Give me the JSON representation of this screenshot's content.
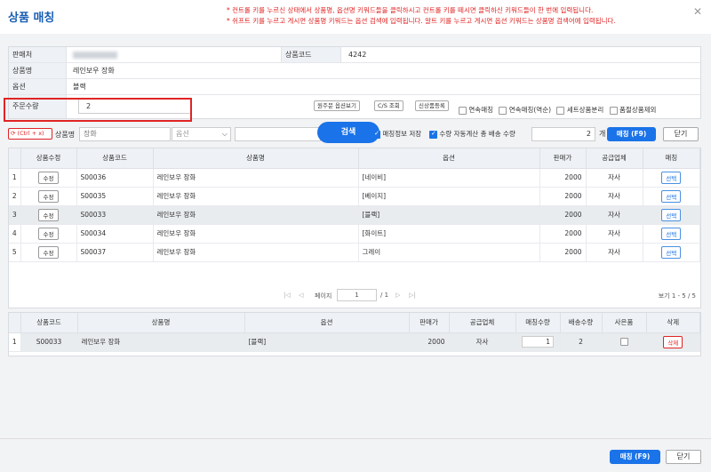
{
  "dialog": {
    "title": "상품 매칭",
    "notes": [
      "* 컨트롤 키를 누르신 상태에서 상품명, 옵션명 키워드들을 클릭하시고 컨트롤 키를 떼시면 클릭하신 키워드들이 한 번에 입력됩니다.",
      "* 쉬프트 키를 누르고 게시면 상품명 키워드는 옵션 검색에 입력됩니다. 알트 키를 누르고 게시면 옵션 키워드는 상품명 검색어에 입력됩니다."
    ],
    "close": "✕"
  },
  "info": {
    "seller_label": "판매처",
    "product_code_label": "상품코드",
    "product_code": "4242",
    "product_name_label": "상품명",
    "product_name": "레인보우 장화",
    "option_label": "옵션",
    "option": "블랙",
    "order_qty_label": "주문수량",
    "order_qty": "2",
    "buttons": [
      "원주문 옵션보기",
      "C/S 조회",
      "신상품등록"
    ],
    "checks": [
      {
        "label": "연속매칭",
        "checked": false
      },
      {
        "label": "연속매칭(역순)",
        "checked": false
      },
      {
        "label": "세트상품분리",
        "checked": false
      },
      {
        "label": "품절상품제외",
        "checked": false
      }
    ]
  },
  "search": {
    "ctrl_btn": "(Ctrl + x)",
    "name_label": "상품명",
    "name_value": "장화",
    "option_placeholder": "옵션",
    "search_btn": "검색",
    "save_match_info": "매칭정보 저장",
    "auto_qty": "수량 자동계산",
    "total_label": "총 배송 수량",
    "total_value": "2",
    "unit": "개",
    "match_btn": "매칭 (F9)",
    "close_btn": "닫기"
  },
  "grid1": {
    "headers": [
      "",
      "상품수정",
      "상품코드",
      "상품명",
      "옵션",
      "판매가",
      "공급업체",
      "매칭"
    ],
    "rows": [
      {
        "no": "1",
        "edit": "수정",
        "code": "S00036",
        "name": "레인보우 장화",
        "option": "[네이비]",
        "price": "2000",
        "supplier": "자사",
        "select": "선택"
      },
      {
        "no": "2",
        "edit": "수정",
        "code": "S00035",
        "name": "레인보우 장화",
        "option": "[베이지]",
        "price": "2000",
        "supplier": "자사",
        "select": "선택"
      },
      {
        "no": "3",
        "edit": "수정",
        "code": "S00033",
        "name": "레인보우 장화",
        "option": "[블랙]",
        "price": "2000",
        "supplier": "자사",
        "select": "선택"
      },
      {
        "no": "4",
        "edit": "수정",
        "code": "S00034",
        "name": "레인보우 장화",
        "option": "[화이트]",
        "price": "2000",
        "supplier": "자사",
        "select": "선택"
      },
      {
        "no": "5",
        "edit": "수정",
        "code": "S00037",
        "name": "레인보우 장화",
        "option": "그레이",
        "price": "2000",
        "supplier": "자사",
        "select": "선택"
      }
    ]
  },
  "pager": {
    "nav_first": "|◁",
    "nav_prev": "◁",
    "page_label": "페이지",
    "page": "1",
    "of": "/ 1",
    "nav_next": "▷",
    "nav_last": "▷|",
    "summary": "보기 1 - 5 / 5"
  },
  "grid2": {
    "headers": [
      "",
      "상품코드",
      "상품명",
      "옵션",
      "판매가",
      "공급업체",
      "매칭수량",
      "배송수량",
      "사은품",
      "삭제"
    ],
    "rows": [
      {
        "no": "1",
        "code": "S00033",
        "name": "레인보우 장화",
        "option": "[블랙]",
        "price": "2000",
        "supplier": "자사",
        "match_qty": "1",
        "ship_qty": "2",
        "delete": "삭제"
      }
    ]
  },
  "footer": {
    "match_btn": "매칭 (F9)",
    "close_btn": "닫기"
  }
}
